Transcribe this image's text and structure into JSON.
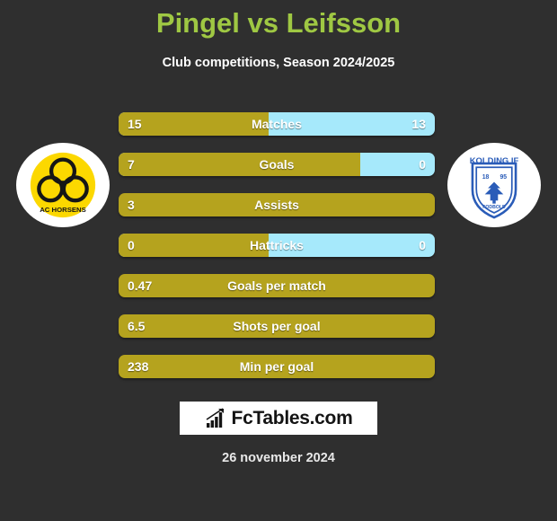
{
  "header": {
    "title": "Pingel vs Leifsson",
    "subtitle": "Club competitions, Season 2024/2025",
    "title_color": "#9fc843"
  },
  "teams": {
    "left": {
      "name": "AC Horsens",
      "logo_icon": "ac-horsens-crest",
      "primary_color": "#fcd800"
    },
    "right": {
      "name": "Kolding IF",
      "logo_icon": "kolding-if-crest",
      "primary_color": "#2a5cb8"
    }
  },
  "colors": {
    "background": "#2f2f2f",
    "bar_left": "#b5a31e",
    "bar_right": "#a6e9fb",
    "text": "#ffffff"
  },
  "chart_data": {
    "type": "bar",
    "title": "Pingel vs Leifsson",
    "subtitle": "Club competitions, Season 2024/2025",
    "series": [
      {
        "name": "Pingel",
        "color": "#b5a31e"
      },
      {
        "name": "Leifsson",
        "color": "#a6e9fb"
      }
    ],
    "categories": [
      "Matches",
      "Goals",
      "Assists",
      "Hattricks",
      "Goals per match",
      "Shots per goal",
      "Min per goal"
    ],
    "rows": [
      {
        "label": "Matches",
        "left": "15",
        "right": "13",
        "left_pct": 47.5,
        "has_right": true
      },
      {
        "label": "Goals",
        "left": "7",
        "right": "0",
        "left_pct": 76.5,
        "has_right": true
      },
      {
        "label": "Assists",
        "left": "3",
        "right": "",
        "left_pct": 100,
        "has_right": false
      },
      {
        "label": "Hattricks",
        "left": "0",
        "right": "0",
        "left_pct": 47.5,
        "has_right": true
      },
      {
        "label": "Goals per match",
        "left": "0.47",
        "right": "",
        "left_pct": 100,
        "has_right": false
      },
      {
        "label": "Shots per goal",
        "left": "6.5",
        "right": "",
        "left_pct": 100,
        "has_right": false
      },
      {
        "label": "Min per goal",
        "left": "238",
        "right": "",
        "left_pct": 100,
        "has_right": false
      }
    ]
  },
  "footer": {
    "brand": "FcTables.com",
    "brand_icon": "bar-chart-trend-icon",
    "date": "26 november 2024"
  }
}
